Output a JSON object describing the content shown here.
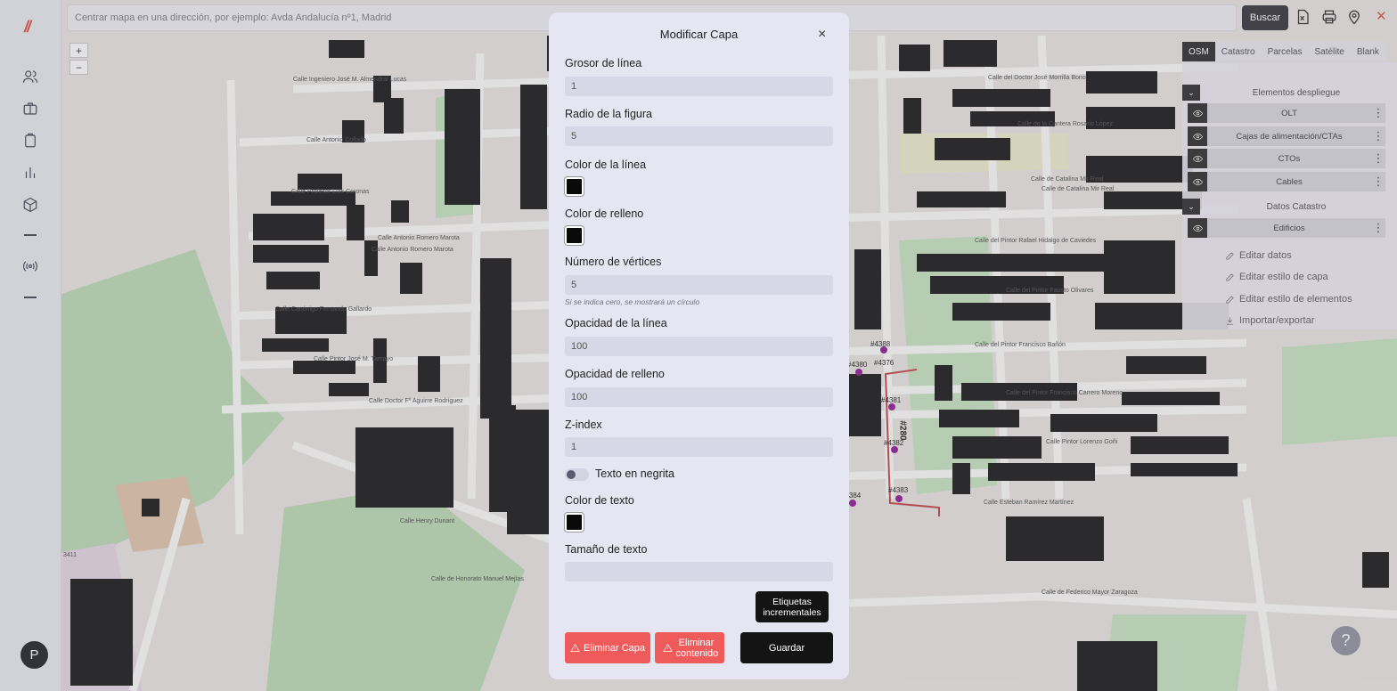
{
  "app": {
    "logo": "//"
  },
  "sidebar": {
    "items": [
      {
        "icon": "users-icon"
      },
      {
        "icon": "briefcase-icon"
      },
      {
        "icon": "clipboard-icon"
      },
      {
        "icon": "bar-chart-icon"
      },
      {
        "icon": "cube-icon"
      },
      {
        "icon": "minus-icon"
      },
      {
        "icon": "broadcast-icon"
      },
      {
        "icon": "minus-icon"
      }
    ],
    "avatar": "P"
  },
  "search": {
    "placeholder": "Centrar mapa en una dirección, por ejemplo: Avda Andalucía nº1, Madrid",
    "button": "Buscar"
  },
  "toolbar": {
    "icons": [
      "excel-icon",
      "printer-icon",
      "location-pin-icon"
    ],
    "close": "✕"
  },
  "zoom": {
    "in": "+",
    "out": "−"
  },
  "basemaps": {
    "tabs": [
      "OSM",
      "Catastro",
      "Parcelas",
      "Satélite",
      "Blank"
    ],
    "active": "OSM"
  },
  "layers": {
    "group1": {
      "title": "Elementos despliegue",
      "items": [
        "OLT",
        "Cajas de alimentación/CTAs",
        "CTOs",
        "Cables"
      ]
    },
    "group2": {
      "title": "Datos Catastro",
      "items": [
        "Edificios"
      ]
    },
    "context_menu": [
      "Editar datos",
      "Editar estilo de capa",
      "Editar estilo de elementos",
      "Importar/exportar"
    ]
  },
  "map": {
    "streets": [
      "Calle Ingeniero José M. Almendral Lucas",
      "Calle Antonio Collado",
      "Calle Profesor Luis Coronas",
      "Calle Antonio Romero Marota",
      "Calle Antonio Romero Marota",
      "Calle Canónigo Fernando Gallardo",
      "Calle Pintor José M. Tamayo",
      "Calle Doctor Fº Aguirre Rodríguez",
      "Calle Henry Dunant",
      "Calle de Honorato Manuel Mejías",
      "Calle del Doctor José Morrilla Bono",
      "Calle de la Cantera Rosario López",
      "Calle de Catalina Mir Real",
      "Calle de Catalina Mir Real",
      "Calle del Pintor Rafael Hidalgo de Caviedes",
      "Calle del Pintor Fausto Olivares",
      "Calle del Pintor Francisco Bañón",
      "Calle del Pintor Francisco Carrero Moreno",
      "Calle Pintor Lorenzo Goñi",
      "Calle Esteban Ramírez Martínez",
      "Calle de Federico Mayor Zaragoza"
    ],
    "markers": [
      "#4388",
      "#4380",
      "#4376",
      "#4381",
      "#4382",
      "#4384",
      "#4383"
    ],
    "route_label": "#280",
    "corner_label": "3411"
  },
  "modal": {
    "title": "Modificar Capa",
    "close": "×",
    "fields": {
      "line_width": {
        "label": "Grosor de línea",
        "value": "1"
      },
      "shape_radius": {
        "label": "Radio de la figura",
        "value": "5"
      },
      "line_color": {
        "label": "Color de la línea",
        "value": "#0a0a0a"
      },
      "fill_color": {
        "label": "Color de relleno",
        "value": "#0a0a0a"
      },
      "vertices": {
        "label": "Número de vértices",
        "value": "5",
        "hint": "Si se indica cero, se mostrará un círculo"
      },
      "line_opacity": {
        "label": "Opacidad de la línea",
        "value": "100"
      },
      "fill_opacity": {
        "label": "Opacidad de relleno",
        "value": "100"
      },
      "z_index": {
        "label": "Z-index",
        "value": "1"
      },
      "bold_text": {
        "label": "Texto en negrita",
        "checked": false
      },
      "text_color": {
        "label": "Color de texto",
        "value": "#0a0a0a"
      },
      "text_size": {
        "label": "Tamaño de texto",
        "value": ""
      }
    },
    "buttons": {
      "incremental": "Etiquetas incrementales",
      "delete_layer": "Eliminar Capa",
      "delete_content": "Eliminar contenido",
      "save": "Guardar"
    }
  },
  "help": "?"
}
